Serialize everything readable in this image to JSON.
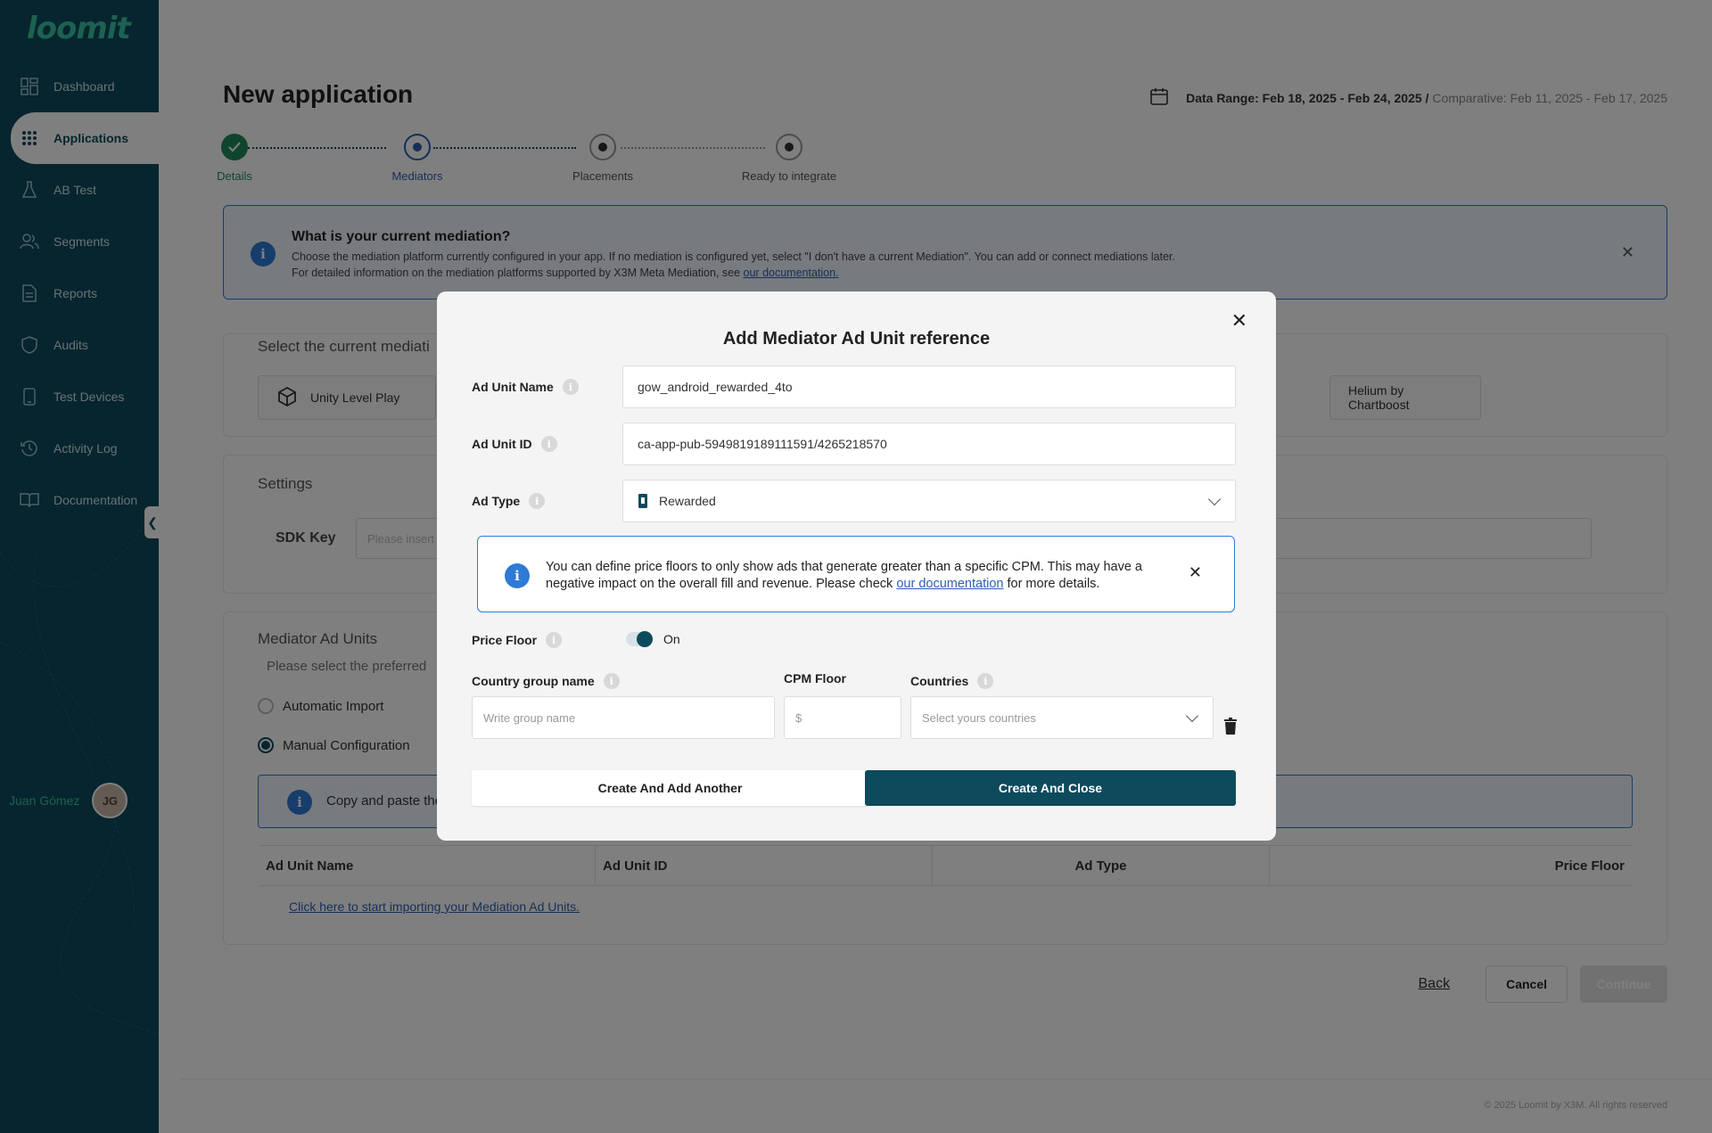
{
  "brand": {
    "logo": "loomit",
    "primary_color": "#0d4a5c",
    "accent_color": "#39c2a3",
    "info_color": "#2d7bd6"
  },
  "sidebar": {
    "items": [
      {
        "label": "Dashboard",
        "icon": "dashboard-icon"
      },
      {
        "label": "Applications",
        "icon": "grid-icon"
      },
      {
        "label": "AB Test",
        "icon": "flask-icon"
      },
      {
        "label": "Segments",
        "icon": "users-icon"
      },
      {
        "label": "Reports",
        "icon": "file-icon"
      },
      {
        "label": "Audits",
        "icon": "shield-icon"
      },
      {
        "label": "Test Devices",
        "icon": "phone-icon"
      },
      {
        "label": "Activity Log",
        "icon": "history-icon"
      },
      {
        "label": "Documentation",
        "icon": "book-icon"
      }
    ],
    "user_name": "Juan Gómez",
    "avatar_initials": "JG"
  },
  "header": {
    "title": "New application",
    "date_range_label": "Data Range: Feb 18, 2025 - Feb 24, 2025 /",
    "comparative": "Comparative: Feb 11, 2025 - Feb 17, 2025"
  },
  "stepper": {
    "steps": [
      {
        "label": "Details",
        "state": "done"
      },
      {
        "label": "Mediators",
        "state": "current"
      },
      {
        "label": "Placements",
        "state": "pending"
      },
      {
        "label": "Ready to integrate",
        "state": "pending"
      }
    ]
  },
  "banner": {
    "title": "What is your current mediation?",
    "line1": "Choose the mediation platform currently configured in your app. If no mediation is configured yet, select \"I don't have a current Mediation\". You can add or connect mediations later.",
    "line2_prefix": "For detailed information on the mediation platforms supported by X3M Meta Mediation, see ",
    "line2_link": "our documentation."
  },
  "mediation_card": {
    "title": "Select the current mediati",
    "option_left": "Unity Level Play",
    "option_right": "Helium by Chartboost"
  },
  "settings_card": {
    "title": "Settings",
    "sdk_key_label": "SDK Key",
    "sdk_key_placeholder": "Please insert"
  },
  "ad_units_card": {
    "title": "Mediator Ad Units",
    "subtitle": "Please select the preferred",
    "radio_auto": "Automatic Import",
    "radio_manual": "Manual Configuration",
    "info_text": "Copy and paste the",
    "columns": [
      "Ad Unit Name",
      "Ad Unit ID",
      "Ad Type",
      "Price Floor"
    ],
    "import_link": "Click here to start importing your Mediation Ad Units."
  },
  "footer": {
    "back": "Back",
    "cancel": "Cancel",
    "continue": "Continue",
    "copyright": "© 2025 Loomit by X3M. All rights reserved"
  },
  "modal": {
    "title": "Add Mediator Ad Unit reference",
    "ad_unit_name_label": "Ad Unit Name",
    "ad_unit_name_value": "gow_android_rewarded_4to",
    "ad_unit_id_label": "Ad Unit ID",
    "ad_unit_id_value": "ca-app-pub-5949819189111591/4265218570",
    "ad_type_label": "Ad Type",
    "ad_type_value": "Rewarded",
    "info_prefix": "You can define price floors to only show ads that generate greater than a specific CPM. This may have a negative impact on the overall fill and revenue. Please check ",
    "info_link": "our documentation",
    "info_suffix": " for more details.",
    "price_floor_label": "Price Floor",
    "price_floor_state": "On",
    "country_group_label": "Country group name",
    "country_group_placeholder": "Write group name",
    "cpm_floor_label": "CPM Floor",
    "cpm_floor_placeholder": "$",
    "countries_label": "Countries",
    "countries_placeholder": "Select yours countries",
    "btn_add_another": "Create And Add Another",
    "btn_close": "Create And Close"
  }
}
